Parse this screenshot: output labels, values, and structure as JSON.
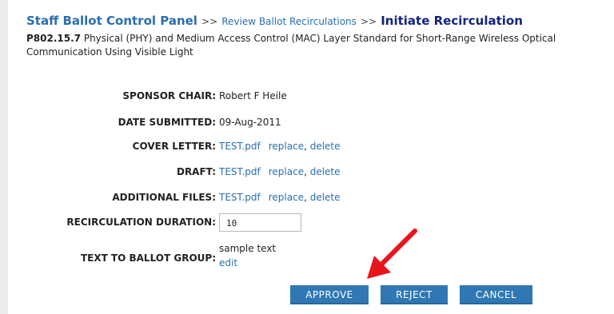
{
  "header": {
    "title": "Staff Ballot Control Panel",
    "separator": ">>",
    "crumb": "Review Ballot Recirculations",
    "current": "Initiate Recirculation"
  },
  "project": {
    "id": "P802.15.7",
    "description": "Physical (PHY) and Medium Access Control (MAC) Layer Standard for Short-Range Wireless Optical Communication Using Visible Light"
  },
  "fields": {
    "sponsor_chair": {
      "label": "SPONSOR CHAIR:",
      "value": "Robert F Heile"
    },
    "date_submitted": {
      "label": "DATE SUBMITTED:",
      "value": "09-Aug-2011"
    },
    "cover_letter": {
      "label": "COVER LETTER:",
      "file": "TEST.pdf",
      "replace": "replace",
      "comma": ",",
      "delete": "delete"
    },
    "draft": {
      "label": "DRAFT:",
      "file": "TEST.pdf",
      "replace": "replace",
      "comma": ",",
      "delete": "delete"
    },
    "additional_files": {
      "label": "ADDITIONAL FILES:",
      "file": "TEST.pdf",
      "replace": "replace",
      "comma": ",",
      "delete": "delete"
    },
    "recirculation_duration": {
      "label": "RECIRCULATION DURATION:",
      "value": "10"
    },
    "text_to_ballot_group": {
      "label": "TEXT TO BALLOT GROUP:",
      "value": "sample text",
      "edit": "edit"
    }
  },
  "buttons": {
    "approve": "APPROVE",
    "reject": "REJECT",
    "cancel": "CANCEL"
  },
  "colors": {
    "link": "#2a6fb0",
    "button": "#2f78b4",
    "arrow": "#e8141b"
  }
}
